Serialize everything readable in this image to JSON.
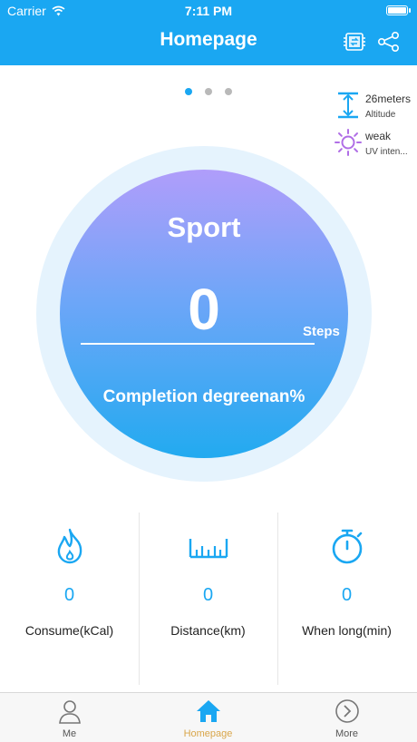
{
  "status_bar": {
    "carrier": "Carrier",
    "time": "7:11 PM"
  },
  "header": {
    "title": "Homepage",
    "sync_icon": "sync-device-icon",
    "share_icon": "share-icon"
  },
  "pager": {
    "count": 3,
    "active_index": 0
  },
  "altitude": {
    "value": "26meters",
    "label": "Altitude",
    "icon": "altitude-icon"
  },
  "uv": {
    "value": "weak",
    "label": "UV inten...",
    "icon": "sun-icon"
  },
  "sport": {
    "title": "Sport",
    "steps": "0",
    "steps_unit": "Steps",
    "completion": "Completion degreenan%"
  },
  "stats": [
    {
      "icon": "flame-icon",
      "value": "0",
      "label": "Consume(kCal)"
    },
    {
      "icon": "ruler-icon",
      "value": "0",
      "label": "Distance(km)"
    },
    {
      "icon": "stopwatch-icon",
      "value": "0",
      "label": "When long(min)"
    }
  ],
  "tabs": [
    {
      "label": "Me",
      "icon": "person-icon"
    },
    {
      "label": "Homepage",
      "icon": "home-icon",
      "active": true
    },
    {
      "label": "More",
      "icon": "chevron-right-circle-icon"
    }
  ],
  "colors": {
    "brand": "#1aa7f2",
    "uv_purple": "#b06ee6",
    "active_tab": "#d9a64a"
  }
}
